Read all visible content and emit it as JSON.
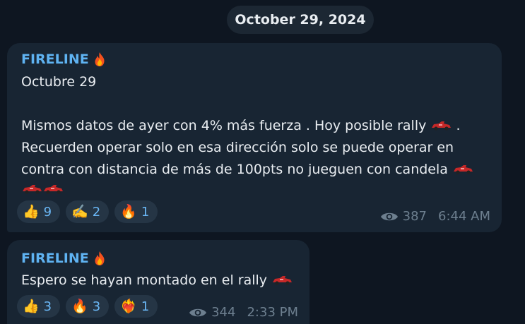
{
  "date_separator": "October 29, 2024",
  "messages": [
    {
      "sender": "FIRELINE",
      "sender_icon": "fire-emoji",
      "lines": [
        "Octubre 29",
        "",
        "Mismos datos de ayer con 4% más fuerza . Hoy posible rally",
        "Recuerden operar solo en esa dirección solo se puede operar en",
        "contra con distancia de más de 100pts no jueguen con candela"
      ],
      "line3_suffix": ".",
      "reactions": [
        {
          "icon": "thumbs-up",
          "glyph": "👍",
          "count": "9"
        },
        {
          "icon": "writing-hand",
          "glyph": "✍️",
          "count": "2"
        },
        {
          "icon": "fire",
          "glyph": "🔥",
          "count": "1"
        }
      ],
      "views": "387",
      "time": "6:44 AM"
    },
    {
      "sender": "FIRELINE",
      "sender_icon": "fire-emoji",
      "lines": [
        "Espero se hayan montado en el rally"
      ],
      "reactions": [
        {
          "icon": "thumbs-up",
          "glyph": "👍",
          "count": "3"
        },
        {
          "icon": "fire",
          "glyph": "🔥",
          "count": "3"
        },
        {
          "icon": "heart-on-fire",
          "glyph": "❤️‍🔥",
          "count": "1"
        }
      ],
      "views": "344",
      "time": "2:33 PM"
    }
  ],
  "colors": {
    "background": "#0e1621",
    "bubble": "#182533",
    "sender": "#5fb3f2",
    "reaction_count": "#6ab7f5",
    "meta": "#6d7f8f"
  }
}
